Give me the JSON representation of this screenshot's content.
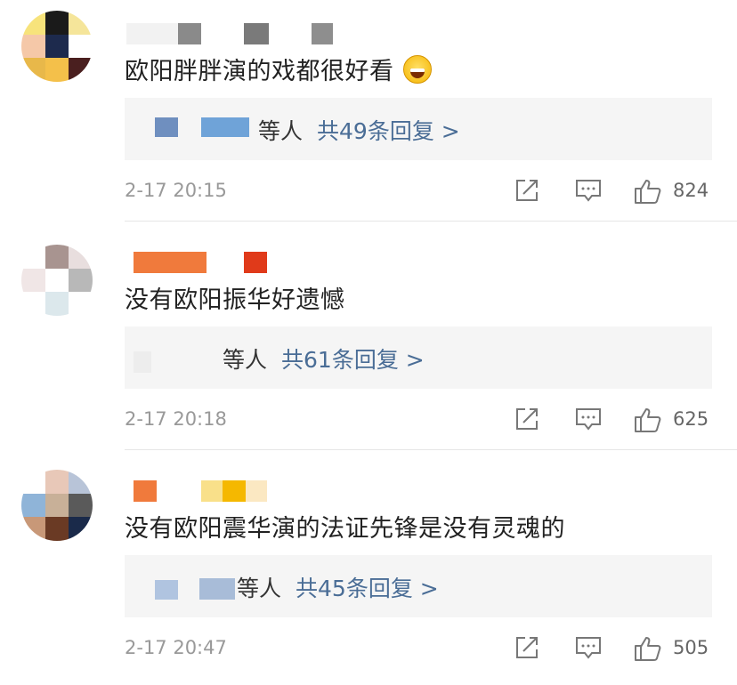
{
  "comments": [
    {
      "text": "欧阳胖胖演的戏都很好看",
      "has_emoji": true,
      "emoji_icon": "grinning-face-icon",
      "reply_suffix": "等人",
      "reply_link": "共49条回复 >",
      "time": "2-17 20:15",
      "likes": "824"
    },
    {
      "text": "没有欧阳振华好遗憾",
      "has_emoji": false,
      "reply_suffix": "等人",
      "reply_link": "共61条回复 >",
      "time": "2-17 20:18",
      "likes": "625"
    },
    {
      "text": "没有欧阳震华演的法证先锋是没有灵魂的",
      "has_emoji": false,
      "reply_suffix": "等人",
      "reply_link": "共45条回复 >",
      "time": "2-17 20:47",
      "likes": "505"
    }
  ],
  "icons": {
    "share": "share-icon",
    "comment": "comment-icon",
    "like": "thumbs-up-icon"
  },
  "colors": {
    "reply_link": "#4a6d96",
    "reply_bg": "#f5f5f5",
    "time": "#999999"
  }
}
